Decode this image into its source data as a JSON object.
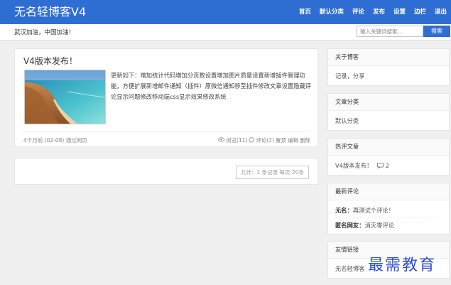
{
  "header": {
    "site_title": "无名轻博客V4",
    "nav": [
      "首页",
      "默认分类",
      "评论",
      "发布",
      "设置",
      "边栏",
      "退出"
    ]
  },
  "subbar": {
    "slogan": "武汉加油，中国加油！",
    "search_placeholder": "输入关键词搜索...",
    "search_button": "搜索"
  },
  "post": {
    "title": "V4版本发布！",
    "excerpt": "更新如下：增加统计代码增加分页数设置增加图片质量设置新增插件管理功能，方便扩展新增邮件通知（插件）原微信通知移至插件修改文章设置隐藏评论显示问题修改移动端css显示效果修改系统",
    "meta_time": "4个月前 (02-08)",
    "meta_source": "通过网页",
    "views": "浏览(11)",
    "comments": "评论(2)",
    "top": "置顶",
    "edit": "编辑",
    "delete": "删除"
  },
  "pager": {
    "text": "共计：1 条记录 每页:20条"
  },
  "sidebar": {
    "about": {
      "title": "关于博客",
      "text": "记录，分享"
    },
    "categories": {
      "title": "文章分类",
      "items": [
        "默认分类"
      ]
    },
    "hot": {
      "title": "热评文章",
      "item": "V4版本发布！",
      "count": "2"
    },
    "recent_comments": {
      "title": "最新评论",
      "items": [
        {
          "author": "无名：",
          "text": "再测试个评论！"
        },
        {
          "author": "匿名网友：",
          "text": "消灭零评论"
        }
      ]
    },
    "links": {
      "title": "友情链接",
      "items": [
        "无名轻博客"
      ]
    }
  },
  "watermark": "最需教育",
  "colors": {
    "accent": "#2e6ed3",
    "background": "#f0f0f0"
  }
}
